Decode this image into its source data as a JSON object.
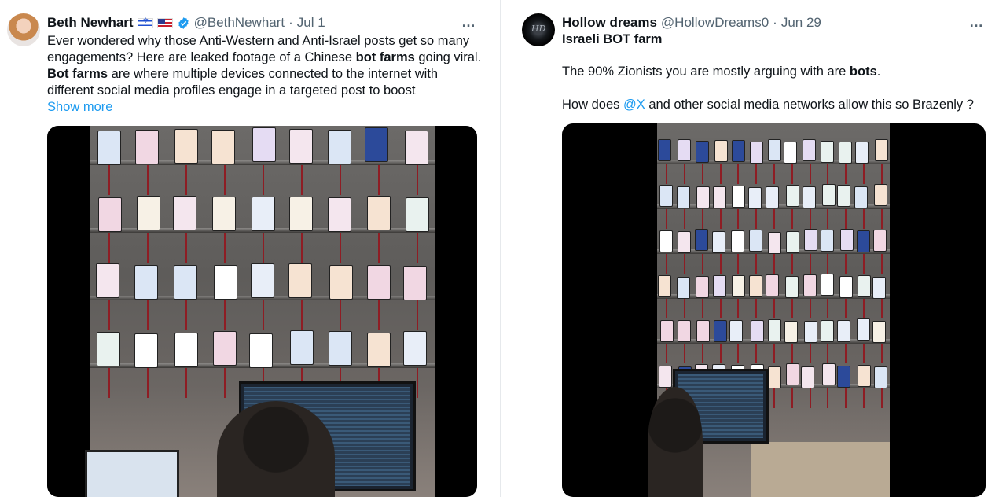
{
  "left_tweet": {
    "author_name": "Beth Newhart",
    "handle": "@BethNewhart",
    "date": "Jul 1",
    "flags": [
      "israel-flag",
      "us-flag"
    ],
    "verified": true,
    "more_icon": "…",
    "text": {
      "t1": "Ever wondered why those Anti-Western and Anti-Israel posts get so many engagements?  Here are leaked footage of a Chinese ",
      "b1": "bot farms",
      "t2": " going viral. ",
      "b2": "Bot farms",
      "t3": " are where multiple devices connected to the internet with different social media profiles engage in a targeted post to boost"
    },
    "show_more": "Show more"
  },
  "right_tweet": {
    "author_name": "Hollow dreams",
    "handle": "@HollowDreams0",
    "date": "Jun 29",
    "avatar_text": "HD",
    "more_icon": "…",
    "title": "Israeli BOT farm",
    "line1_pre": "The 90% Zionists you are mostly arguing with are  ",
    "line1_bold": "bots",
    "line1_post": ".",
    "line2_pre": "How does ",
    "line2_mention": "@X",
    "line2_post": " and other social media networks allow this so Brazenly ?"
  },
  "colors": {
    "link": "#1d9bf0",
    "secondary_text": "#536471",
    "verified": "#1d9bf0",
    "cable": "#8e1d24"
  }
}
